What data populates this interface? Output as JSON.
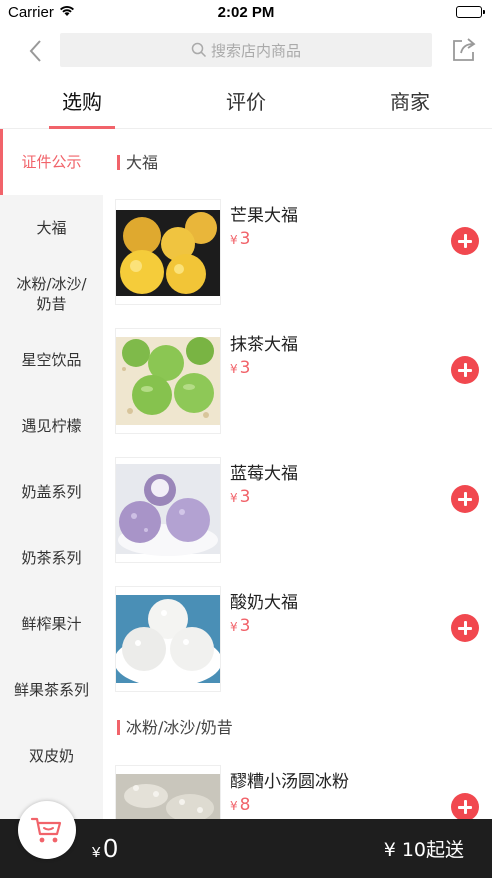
{
  "status_bar": {
    "carrier": "Carrier",
    "time": "2:02 PM"
  },
  "search": {
    "placeholder": "搜索店内商品"
  },
  "tabs": [
    {
      "label": "选购",
      "active": true
    },
    {
      "label": "评价",
      "active": false
    },
    {
      "label": "商家",
      "active": false
    }
  ],
  "sidebar": {
    "items": [
      {
        "label": "证件公示",
        "active": true
      },
      {
        "label": "大福"
      },
      {
        "label": "冰粉/冰沙/奶昔"
      },
      {
        "label": "星空饮品"
      },
      {
        "label": "遇见柠檬"
      },
      {
        "label": "奶盖系列"
      },
      {
        "label": "奶茶系列"
      },
      {
        "label": "鲜榨果汁"
      },
      {
        "label": "鲜果茶系列"
      },
      {
        "label": "双皮奶"
      }
    ]
  },
  "sections": [
    {
      "title": "大福",
      "items": [
        {
          "name": "芒果大福",
          "currency": "¥",
          "price": "3",
          "image": "mango-daifuku"
        },
        {
          "name": "抹茶大福",
          "currency": "¥",
          "price": "3",
          "image": "matcha-daifuku"
        },
        {
          "name": "蓝莓大福",
          "currency": "¥",
          "price": "3",
          "image": "blueberry-daifuku"
        },
        {
          "name": "酸奶大福",
          "currency": "¥",
          "price": "3",
          "image": "yogurt-daifuku"
        }
      ]
    },
    {
      "title": "冰粉/冰沙/奶昔",
      "items": [
        {
          "name": "醪糟小汤圆冰粉",
          "currency": "¥",
          "price": "8",
          "image": "rice-wine-ice-jelly"
        }
      ]
    }
  ],
  "cart": {
    "currency": "¥",
    "total": "0",
    "min_order": "¥ 10起送"
  },
  "colors": {
    "accent": "#f1636a",
    "add_button": "#f1484f",
    "cart_bar": "#1e1e1e"
  }
}
